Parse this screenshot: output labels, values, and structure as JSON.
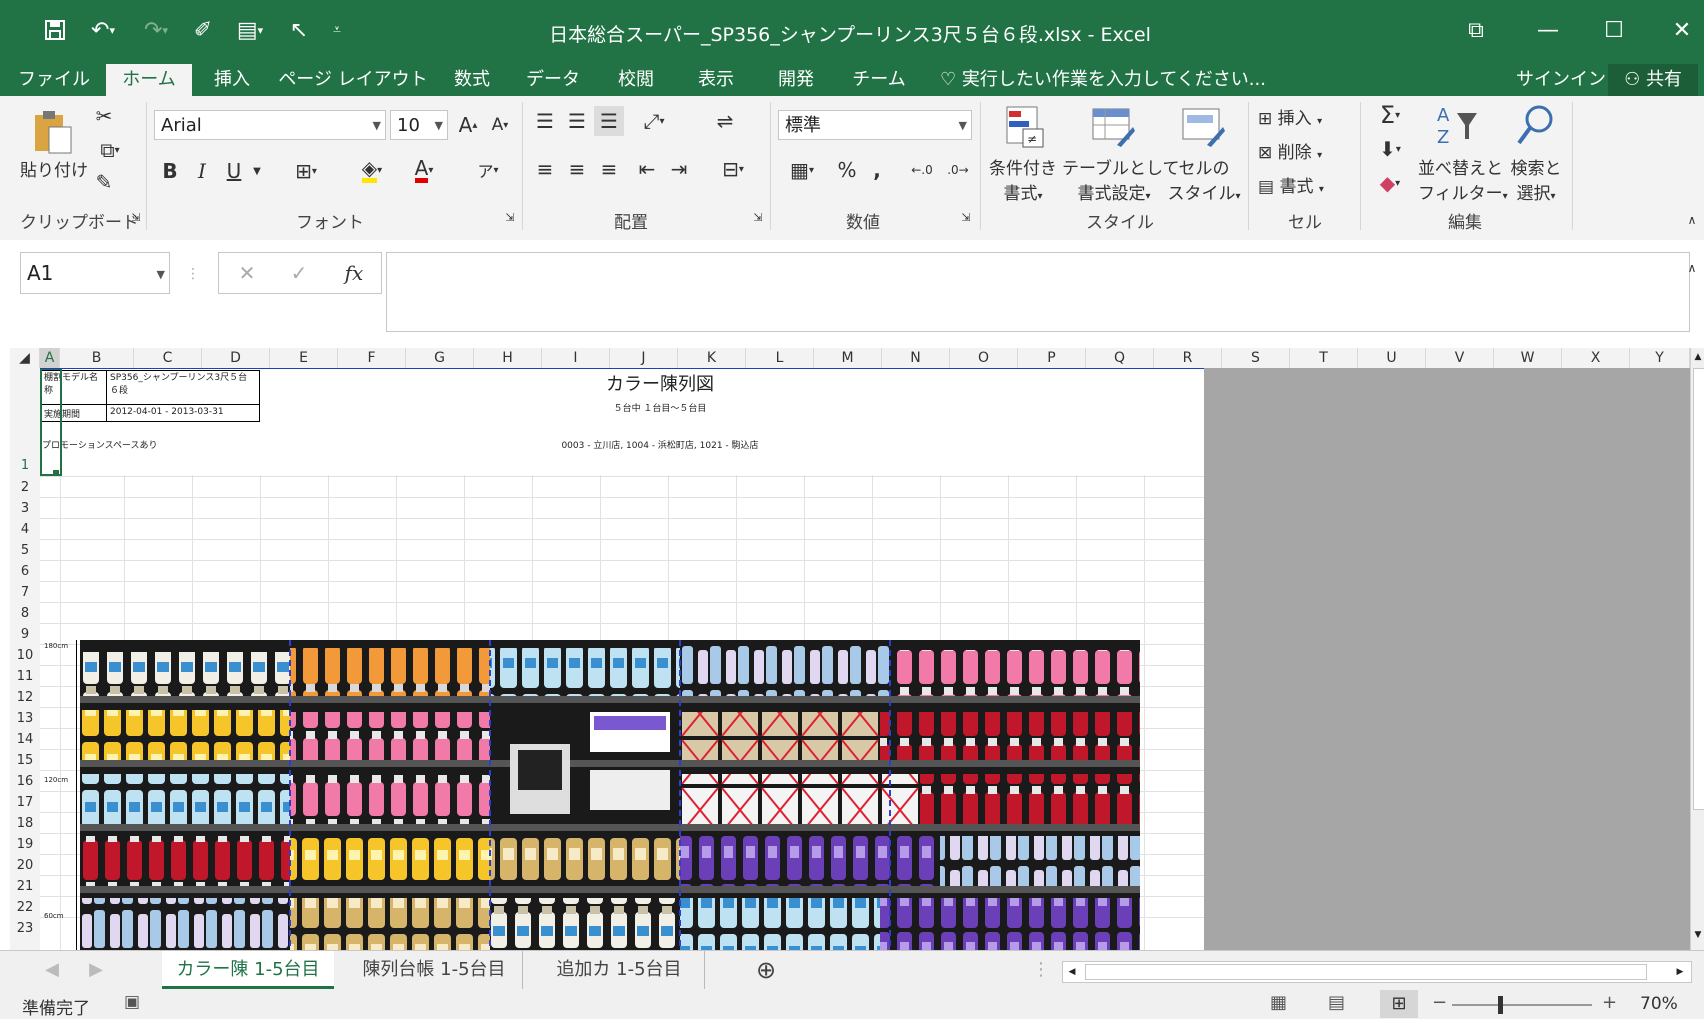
{
  "window": {
    "title": "日本総合スーパー_SP356_シャンプーリンス3尺５台６段.xlsx - Excel",
    "minimize": "—",
    "maximize": "☐",
    "close": "✕",
    "ribbon_display": "⧉"
  },
  "menu": {
    "tabs": [
      "ファイル",
      "ホーム",
      "挿入",
      "ページ レイアウト",
      "数式",
      "データ",
      "校閲",
      "表示",
      "開発",
      "チーム"
    ],
    "tell_me": "実行したい作業を入力してください...",
    "signin": "サインイン",
    "share": "共有"
  },
  "ribbon": {
    "clipboard": {
      "label": "クリップボード",
      "paste": "貼り付け"
    },
    "font": {
      "label": "フォント",
      "name": "Arial",
      "size": "10",
      "bold": "B",
      "italic": "I",
      "underline": "U"
    },
    "alignment": {
      "label": "配置"
    },
    "number": {
      "label": "数値",
      "format": "標準",
      "percent": "%",
      "comma": ","
    },
    "styles": {
      "label": "スタイル",
      "conditional": [
        "条件付き",
        "書式"
      ],
      "table": [
        "テーブルとして",
        "書式設定"
      ],
      "cell": [
        "セルの",
        "スタイル"
      ]
    },
    "cells": {
      "label": "セル",
      "insert": "挿入",
      "delete": "削除",
      "format": "書式"
    },
    "editing": {
      "label": "編集",
      "sort": [
        "並べ替えと",
        "フィルター"
      ],
      "find": [
        "検索と",
        "選択"
      ]
    }
  },
  "formula_bar": {
    "name_box": "A1",
    "fx": "fx",
    "content": ""
  },
  "columns": [
    "A",
    "B",
    "C",
    "D",
    "E",
    "F",
    "G",
    "H",
    "I",
    "J",
    "K",
    "L",
    "M",
    "N",
    "O",
    "P",
    "Q",
    "R",
    "S",
    "T",
    "U",
    "V",
    "W",
    "X",
    "Y"
  ],
  "rows": [
    "1",
    "2",
    "3",
    "4",
    "5",
    "6",
    "7",
    "8",
    "9",
    "10",
    "11",
    "12",
    "13",
    "14",
    "15",
    "16",
    "17",
    "18",
    "19",
    "20",
    "21",
    "22",
    "23"
  ],
  "sheet": {
    "label_model": "棚割モデル名称",
    "value_model": "SP356_シャンプーリンス3尺５台６段",
    "label_period": "実施期間",
    "value_period": "2012-04-01 - 2013-03-31",
    "promo": "プロモーションスペースあり",
    "heading": "カラー陳列図",
    "subheading": "５台中 １台目～５台目",
    "stores": "0003 - 立川店, 1004 - 浜松町店, 1021 - 駒込店",
    "height_marks": [
      "180cm",
      "120cm",
      "60cm"
    ]
  },
  "sheet_tabs": [
    "カラー陳 1-5台目",
    "陳列台帳 1-5台目",
    "追加カ 1-5台目"
  ],
  "status": {
    "ready": "準備完了",
    "zoom": "70%"
  },
  "colors": {
    "accent": "#217346",
    "grey": "#a6a6a6",
    "print_border": "#1f3fbf"
  }
}
